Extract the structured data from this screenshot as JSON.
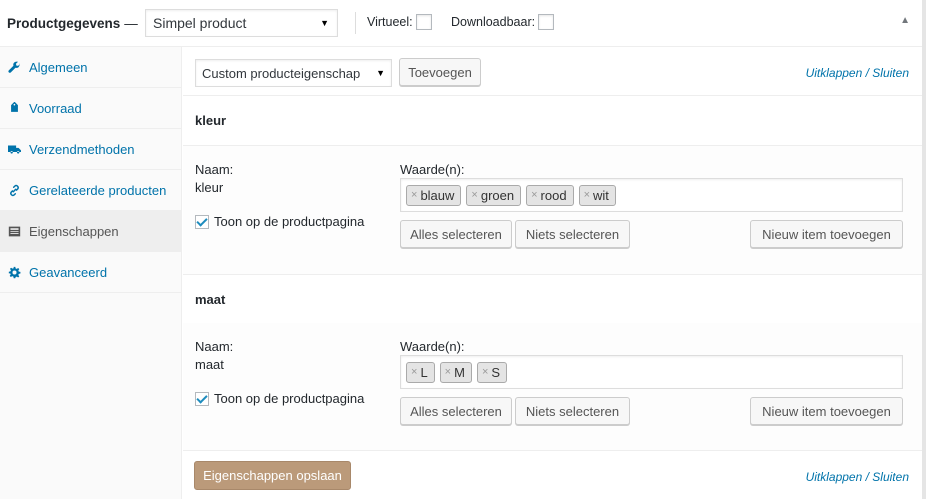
{
  "header": {
    "title": "Productgegevens",
    "dash": "—",
    "product_type": "Simpel product",
    "virtual_label": "Virtueel:",
    "downloadable_label": "Downloadbaar:"
  },
  "sidebar": {
    "items": [
      {
        "label": "Algemeen",
        "icon": "wrench-icon"
      },
      {
        "label": "Voorraad",
        "icon": "tag-icon"
      },
      {
        "label": "Verzendmethoden",
        "icon": "truck-icon"
      },
      {
        "label": "Gerelateerde producten",
        "icon": "link-icon"
      },
      {
        "label": "Eigenschappen",
        "icon": "list-icon"
      },
      {
        "label": "Geavanceerd",
        "icon": "gear-icon"
      }
    ],
    "active_index": 4
  },
  "toolbar": {
    "attribute_select": "Custom producteigenschap",
    "add_label": "Toevoegen",
    "expand_label": "Uitklappen",
    "separator": "/",
    "collapse_label": "Sluiten"
  },
  "attributes": [
    {
      "title": "kleur",
      "name_label": "Naam:",
      "name_value": "kleur",
      "values_label": "Waarde(n):",
      "values": [
        "blauw",
        "groen",
        "rood",
        "wit"
      ],
      "visible_label": "Toon op de productpagina",
      "select_all_label": "Alles selecteren",
      "select_none_label": "Niets selecteren",
      "add_new_label": "Nieuw item toevoegen"
    },
    {
      "title": "maat",
      "name_label": "Naam:",
      "name_value": "maat",
      "values_label": "Waarde(n):",
      "values": [
        "L",
        "M",
        "S"
      ],
      "visible_label": "Toon op de productpagina",
      "select_all_label": "Alles selecteren",
      "select_none_label": "Niets selecteren",
      "add_new_label": "Nieuw item toevoegen"
    }
  ],
  "footer": {
    "save_label": "Eigenschappen opslaan",
    "expand_label": "Uitklappen",
    "separator": "/",
    "collapse_label": "Sluiten"
  },
  "colors": {
    "link": "#0073aa",
    "primary_button": "#bb9a7a"
  }
}
